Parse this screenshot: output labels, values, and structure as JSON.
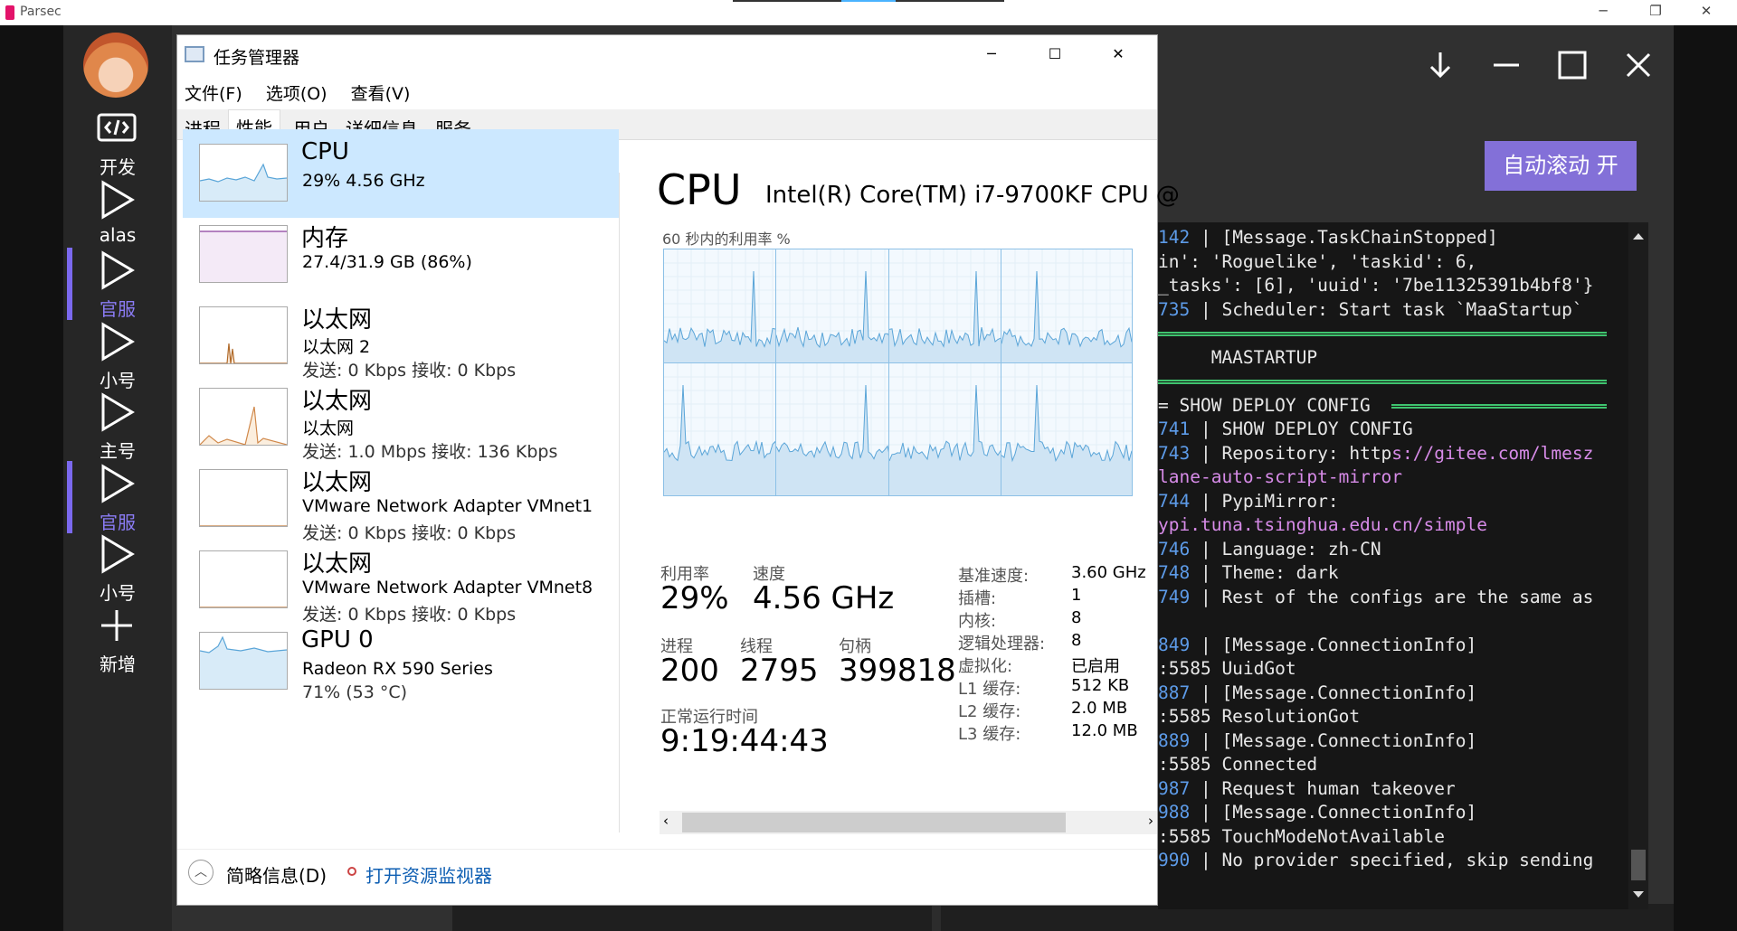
{
  "parsec": {
    "title": "Parsec",
    "min": "─",
    "restore": "❐",
    "close": "✕"
  },
  "sidebar": {
    "items": [
      {
        "label": "开发",
        "icon": "code-icon",
        "active": false
      },
      {
        "label": "alas",
        "icon": "play-icon",
        "active": false
      },
      {
        "label": "官服",
        "icon": "play-icon",
        "active": true
      },
      {
        "label": "小号",
        "icon": "play-icon",
        "active": false
      },
      {
        "label": "主号",
        "icon": "play-icon",
        "active": false
      },
      {
        "label": "官服",
        "icon": "play-icon",
        "active": true
      },
      {
        "label": "小号",
        "icon": "play-icon",
        "active": false
      },
      {
        "label": "新增",
        "icon": "plus-icon",
        "active": false
      }
    ]
  },
  "alas": {
    "auto_scroll": "自动滚动 开",
    "log": [
      {
        "num": "142",
        "rest": " | [Message.TaskChainStopped]"
      },
      {
        "num": "",
        "rest": "in': 'Roguelike', 'taskid': 6,"
      },
      {
        "num": "",
        "rest": "_tasks': [6], 'uuid': '7be11325391b4bf8'}"
      },
      {
        "num": "735",
        "rest": " | Scheduler: Start task `MaaStartup`"
      },
      {
        "num": "",
        "rest": "",
        "sep": true
      },
      {
        "num": "",
        "rest": "     MAASTARTUP"
      },
      {
        "num": "",
        "rest": "",
        "sep": true
      },
      {
        "num": "",
        "rest": "= SHOW DEPLOY CONFIG ",
        "tail_sep": true
      },
      {
        "num": "741",
        "rest": " | SHOW DEPLOY CONFIG"
      },
      {
        "num": "743",
        "rest": " | Repository: http",
        "hl": "s://gitee.com/lmesz"
      },
      {
        "num": "",
        "rest": "",
        "hl": "lane-auto-script-mirror"
      },
      {
        "num": "744",
        "rest": " | PypiMirror:"
      },
      {
        "num": "",
        "rest": "",
        "hl": "ypi.tuna.tsinghua.edu.cn/simple"
      },
      {
        "num": "746",
        "rest": " | Language: zh-CN"
      },
      {
        "num": "748",
        "rest": " | Theme: dark"
      },
      {
        "num": "749",
        "rest": " | Rest of the configs are the same as"
      },
      {
        "num": "",
        "rest": ""
      },
      {
        "num": "849",
        "rest": " | [Message.ConnectionInfo]"
      },
      {
        "num": "",
        "rest": ":5585 UuidGot"
      },
      {
        "num": "887",
        "rest": " | [Message.ConnectionInfo]"
      },
      {
        "num": "",
        "rest": ":5585 ResolutionGot"
      },
      {
        "num": "889",
        "rest": " | [Message.ConnectionInfo]"
      },
      {
        "num": "",
        "rest": ":5585 Connected"
      },
      {
        "num": "987",
        "rest": " | Request human takeover"
      },
      {
        "num": "988",
        "rest": " | [Message.ConnectionInfo]"
      },
      {
        "num": "",
        "rest": ":5585 TouchModeNotAvailable"
      },
      {
        "num": "990",
        "rest": " | No provider specified, skip sending"
      }
    ]
  },
  "taskmgr": {
    "title": "任务管理器",
    "menu": [
      "文件(F)",
      "选项(O)",
      "查看(V)"
    ],
    "tabs": [
      "进程",
      "性能",
      "用户",
      "详细信息",
      "服务"
    ],
    "selected_tab": 1,
    "side": [
      {
        "name": "CPU",
        "l1": "29% 4.56 GHz",
        "l2": ""
      },
      {
        "name": "内存",
        "l1": "27.4/31.9 GB (86%)",
        "l2": ""
      },
      {
        "name": "以太网",
        "l1": "以太网 2",
        "l2": "发送: 0 Kbps 接收: 0 Kbps"
      },
      {
        "name": "以太网",
        "l1": "以太网",
        "l2": "发送: 1.0 Mbps 接收: 136 Kbps"
      },
      {
        "name": "以太网",
        "l1": "VMware Network Adapter VMnet1",
        "l2": "发送: 0 Kbps 接收: 0 Kbps"
      },
      {
        "name": "以太网",
        "l1": "VMware Network Adapter VMnet8",
        "l2": "发送: 0 Kbps 接收: 0 Kbps"
      },
      {
        "name": "GPU 0",
        "l1": "Radeon RX 590 Series",
        "l2": "71% (53 °C)"
      }
    ],
    "cpu": {
      "heading": "CPU",
      "model": "Intel(R) Core(TM) i7-9700KF CPU @",
      "util_label": "60 秒内的利用率 %",
      "stats": [
        {
          "label": "利用率",
          "value": "29%"
        },
        {
          "label": "速度",
          "value": "4.56 GHz"
        },
        {
          "label": "进程",
          "value": "200"
        },
        {
          "label": "线程",
          "value": "2795"
        },
        {
          "label": "句柄",
          "value": "399818"
        },
        {
          "label": "正常运行时间",
          "value": "9:19:44:43"
        }
      ],
      "specs": [
        {
          "k": "基准速度:",
          "v": "3.60 GHz"
        },
        {
          "k": "插槽:",
          "v": "1"
        },
        {
          "k": "内核:",
          "v": "8"
        },
        {
          "k": "逻辑处理器:",
          "v": "8"
        },
        {
          "k": "虚拟化:",
          "v": "已启用"
        },
        {
          "k": "L1 缓存:",
          "v": "512 KB"
        },
        {
          "k": "L2 缓存:",
          "v": "2.0 MB"
        },
        {
          "k": "L3 缓存:",
          "v": "12.0 MB"
        }
      ]
    },
    "footer": {
      "brief": "简略信息(D)",
      "monitor": "打开资源监视器"
    }
  }
}
